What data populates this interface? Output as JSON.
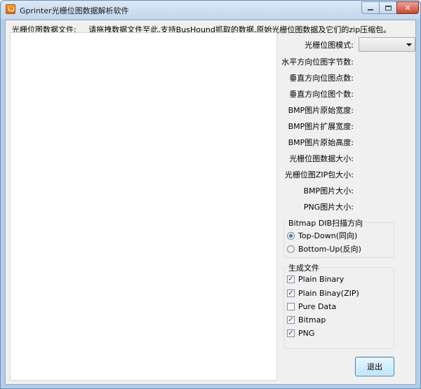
{
  "window": {
    "title": "Gprinter光栅位图数据解析软件",
    "controls": {
      "minimize": "",
      "maximize": "",
      "close": "✕"
    }
  },
  "hint": {
    "label": "光栅位图数据文件:",
    "text": "请拖拽数据文件至此,支持BusHound抓取的数据,原始光栅位图数据及它们的zip压缩包。"
  },
  "fields": {
    "mode": "光栅位图模式:",
    "h_bytes": "水平方向位图字节数:",
    "v_dots": "垂直方向位图点数:",
    "v_count": "垂直方向位图个数:",
    "bmp_orig_width": "BMP图片原始宽度:",
    "bmp_ext_width": "BMP图片扩展宽度:",
    "bmp_orig_height": "BMP图片原始高度:",
    "raster_size": "光栅位图数据大小:",
    "zip_size": "光栅位图ZIP包大小:",
    "bmp_size": "BMP图片大小:",
    "png_size": "PNG图片大小:"
  },
  "mode_select": {
    "value": ""
  },
  "scan_group": {
    "title": "Bitmap DIB扫描方向",
    "options": [
      {
        "label": "Top-Down(同向)",
        "selected": true
      },
      {
        "label": "Bottom-Up(反向)",
        "selected": false
      }
    ]
  },
  "output_group": {
    "title": "生成文件",
    "options": [
      {
        "label": "Plain Binary",
        "checked": true
      },
      {
        "label": "Plain Binay(ZIP)",
        "checked": true
      },
      {
        "label": "Pure Data",
        "checked": false
      },
      {
        "label": "Bitmap",
        "checked": true
      },
      {
        "label": "PNG",
        "checked": true
      }
    ]
  },
  "exit_button": {
    "label": "退出"
  },
  "check_mark": "✓"
}
